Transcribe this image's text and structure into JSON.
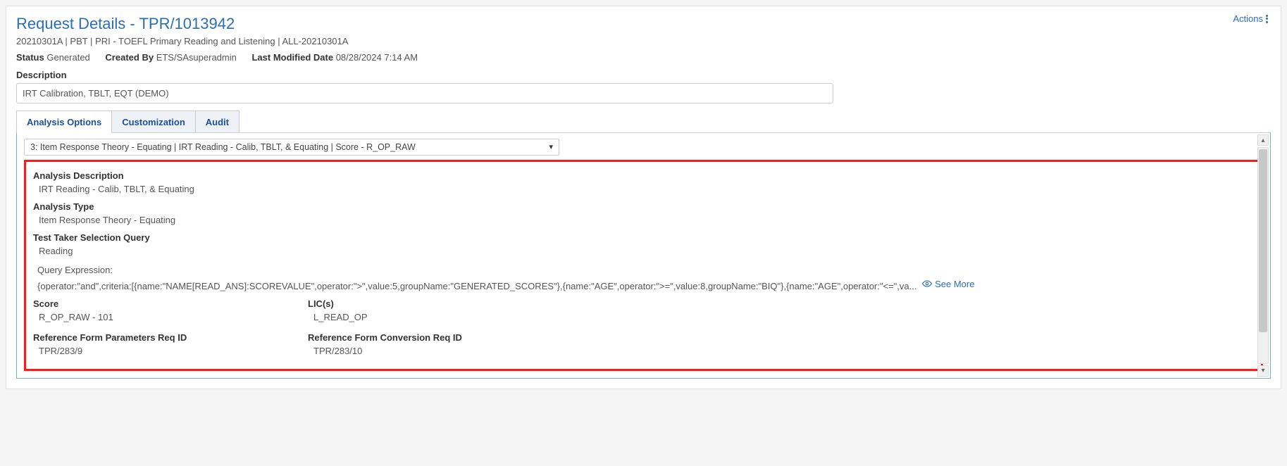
{
  "header": {
    "title": "Request Details - TPR/1013942",
    "subtitle": "20210301A | PBT | PRI - TOEFL Primary Reading and Listening | ALL-20210301A",
    "actions_label": "Actions"
  },
  "meta": {
    "status_label": "Status",
    "status_value": "Generated",
    "created_by_label": "Created By",
    "created_by_value": "ETS/SAsuperadmin",
    "modified_label": "Last Modified Date",
    "modified_value": "08/28/2024 7:14 AM"
  },
  "description": {
    "label": "Description",
    "value": "IRT Calibration, TBLT, EQT (DEMO)"
  },
  "tabs": {
    "analysis": "Analysis Options",
    "customization": "Customization",
    "audit": "Audit"
  },
  "dropdown": {
    "selected": "3: Item Response Theory - Equating | IRT Reading - Calib, TBLT, & Equating | Score - R_OP_RAW"
  },
  "details": {
    "analysis_desc_label": "Analysis Description",
    "analysis_desc_value": "IRT Reading - Calib, TBLT, & Equating",
    "analysis_type_label": "Analysis Type",
    "analysis_type_value": "Item Response Theory - Equating",
    "tt_query_label": "Test Taker Selection Query",
    "tt_query_value": "Reading",
    "query_exp_label": "Query Expression:",
    "query_exp_value": "{operator:\"and\",criteria:[{name:\"NAME[READ_ANS]:SCOREVALUE\",operator:\">\",value:5,groupName:\"GENERATED_SCORES\"},{name:\"AGE\",operator:\">=\",value:8,groupName:\"BIQ\"},{name:\"AGE\",operator:\"<=\",va...",
    "see_more": "See More",
    "score_label": "Score",
    "score_value": "R_OP_RAW - 101",
    "lic_label": "LIC(s)",
    "lic_value": "L_READ_OP",
    "ref_param_label": "Reference Form Parameters Req ID",
    "ref_param_value": "TPR/283/9",
    "ref_conv_label": "Reference Form Conversion Req ID",
    "ref_conv_value": "TPR/283/10"
  }
}
